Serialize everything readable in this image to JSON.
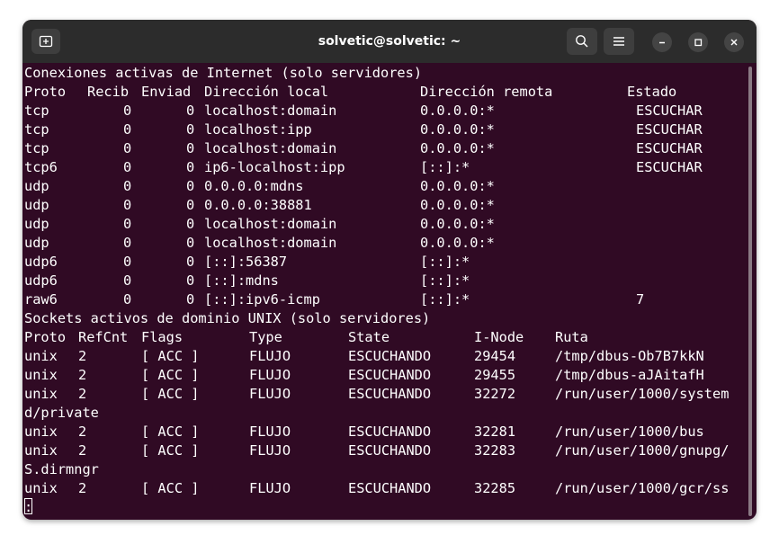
{
  "window": {
    "title": "solvetic@solvetic: ~"
  },
  "header_internet": "Conexiones activas de Internet (solo servidores)",
  "internet_columns": [
    "Proto",
    "Recib",
    "Enviad",
    "Dirección local",
    "Dirección remota",
    "Estado"
  ],
  "internet_rows": [
    [
      "tcp",
      "0",
      "0",
      "localhost:domain",
      "0.0.0.0:*",
      "ESCUCHAR"
    ],
    [
      "tcp",
      "0",
      "0",
      "localhost:ipp",
      "0.0.0.0:*",
      "ESCUCHAR"
    ],
    [
      "tcp",
      "0",
      "0",
      "localhost:domain",
      "0.0.0.0:*",
      "ESCUCHAR"
    ],
    [
      "tcp6",
      "0",
      "0",
      "ip6-localhost:ipp",
      "[::]:*",
      "ESCUCHAR"
    ],
    [
      "udp",
      "0",
      "0",
      "0.0.0.0:mdns",
      "0.0.0.0:*",
      ""
    ],
    [
      "udp",
      "0",
      "0",
      "0.0.0.0:38881",
      "0.0.0.0:*",
      ""
    ],
    [
      "udp",
      "0",
      "0",
      "localhost:domain",
      "0.0.0.0:*",
      ""
    ],
    [
      "udp",
      "0",
      "0",
      "localhost:domain",
      "0.0.0.0:*",
      ""
    ],
    [
      "udp6",
      "0",
      "0",
      "[::]:56387",
      "[::]:*",
      ""
    ],
    [
      "udp6",
      "0",
      "0",
      "[::]:mdns",
      "[::]:*",
      ""
    ],
    [
      "raw6",
      "0",
      "0",
      "[::]:ipv6-icmp",
      "[::]:*",
      "7"
    ]
  ],
  "header_unix": "Sockets activos de dominio UNIX (solo servidores)",
  "unix_columns": [
    "Proto",
    "RefCnt",
    "Flags",
    "Type",
    "State",
    "I-Node",
    "Ruta"
  ],
  "unix_rows": [
    [
      "unix",
      "2",
      "[ ACC ]",
      "FLUJO",
      "ESCUCHANDO",
      "29454",
      "/tmp/dbus-Ob7B7kkN"
    ],
    [
      "unix",
      "2",
      "[ ACC ]",
      "FLUJO",
      "ESCUCHANDO",
      "29455",
      "/tmp/dbus-aJAitafH"
    ],
    [
      "unix",
      "2",
      "[ ACC ]",
      "FLUJO",
      "ESCUCHANDO",
      "32272",
      "/run/user/1000/system"
    ],
    [
      "unix",
      "2",
      "[ ACC ]",
      "FLUJO",
      "ESCUCHANDO",
      "32281",
      "/run/user/1000/bus"
    ],
    [
      "unix",
      "2",
      "[ ACC ]",
      "FLUJO",
      "ESCUCHANDO",
      "32283",
      "/run/user/1000/gnupg/"
    ],
    [
      "unix",
      "2",
      "[ ACC ]",
      "FLUJO",
      "ESCUCHANDO",
      "32285",
      "/run/user/1000/gcr/ss"
    ]
  ],
  "wrap_1": "d/private",
  "wrap_2": "S.dirmngr",
  "prompt": ":",
  "colors": {
    "terminal_bg": "#300a24",
    "titlebar_bg": "#2c2c2c",
    "text": "#ffffff"
  },
  "icons": [
    "new-tab-icon",
    "search-icon",
    "menu-icon",
    "minimize-icon",
    "maximize-icon",
    "close-icon"
  ]
}
